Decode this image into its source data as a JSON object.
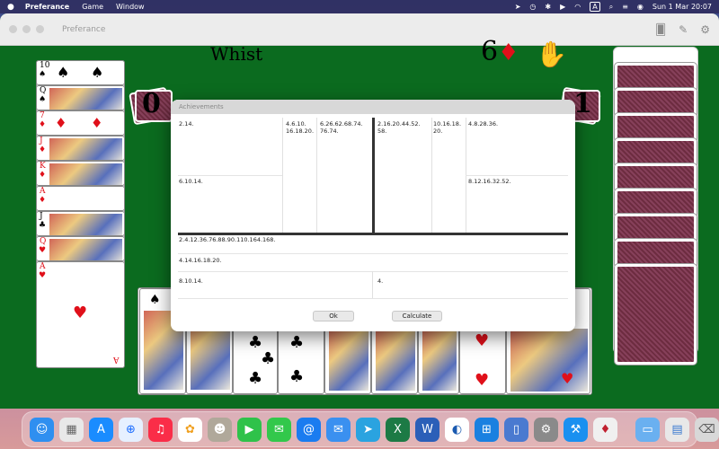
{
  "menubar": {
    "apple": "",
    "app": "Preferance",
    "items": [
      "Game",
      "Window"
    ],
    "input_source": "A",
    "clock": "Sun 1 Mar  20:07"
  },
  "window": {
    "title": "Preferance"
  },
  "table": {
    "mode": "Whist",
    "bid_value": "6",
    "bid_suit": "♦",
    "left_score": "0",
    "right_score": "1"
  },
  "left_column_cards": [
    {
      "rank": "10",
      "suit": "♠",
      "color": "black"
    },
    {
      "rank": "Q",
      "suit": "♠",
      "color": "black"
    },
    {
      "rank": "7",
      "suit": "♦",
      "color": "red"
    },
    {
      "rank": "J",
      "suit": "♦",
      "color": "red"
    },
    {
      "rank": "K",
      "suit": "♦",
      "color": "red"
    },
    {
      "rank": "A",
      "suit": "♦",
      "color": "red"
    },
    {
      "rank": "J",
      "suit": "♣",
      "color": "black"
    },
    {
      "rank": "Q",
      "suit": "♥",
      "color": "red"
    },
    {
      "rank": "A",
      "suit": "♥",
      "color": "red"
    }
  ],
  "bottom_hand_suits": [
    "♠",
    "♣",
    "♣",
    "♣",
    "♣",
    "♥",
    "♥"
  ],
  "dialog": {
    "title": "Achievements",
    "cells": {
      "c1": "2.14.",
      "c2": "4.6.10.\n16.18.20.",
      "c3": "6.26.62.68.74.\n76.74.",
      "c4": "2.16.20.44.52.\n58.",
      "c5": "10.16.18.\n20.",
      "c6": "4.8.28.36.",
      "c7": "6.10.14.",
      "c8": "8.12.16.32.52.",
      "c9": "2.4.12.36.76.88.90.110.164.168.",
      "c10": "4.14.16.18.20.",
      "c11": "8.10.14.",
      "c12": "4."
    },
    "ok_label": "Ok",
    "calculate_label": "Calculate"
  },
  "dock": {
    "apps": [
      "Finder",
      "Launchpad",
      "App Store",
      "Safari",
      "Music",
      "Photos",
      "Contacts",
      "FaceTime",
      "Messages",
      "Mail",
      "Mail",
      "Telegram",
      "Excel",
      "Word",
      "Edge",
      "Windows App",
      "Simulator",
      "System Settings",
      "Xcode",
      "Preferance",
      "Downloads",
      "Preview",
      "Trash"
    ]
  },
  "colors": {
    "felt": "#0b6b1f",
    "card_back": "#7a3448",
    "red_suit": "#e0101a"
  }
}
